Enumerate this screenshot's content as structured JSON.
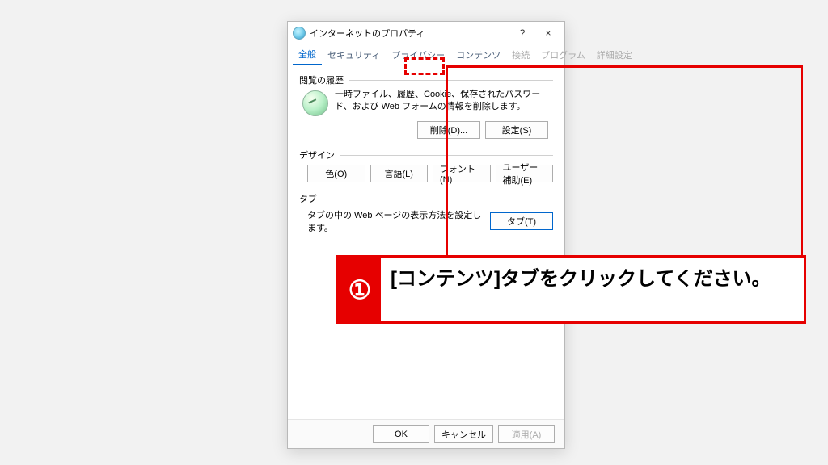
{
  "dialog": {
    "title": "インターネットのプロパティ",
    "help_label": "?",
    "close_label": "×"
  },
  "tabs": {
    "general": "全般",
    "security": "セキュリティ",
    "privacy": "プライバシー",
    "contents": "コンテンツ",
    "connections": "接続",
    "programs": "プログラム",
    "advanced": "詳細設定"
  },
  "history": {
    "group_title": "閲覧の履歴",
    "description": "一時ファイル、履歴、Cookie、保存されたパスワード、および Web フォームの情報を削除します。",
    "delete_btn": "削除(D)...",
    "settings_btn": "設定(S)"
  },
  "design": {
    "group_title": "デザイン",
    "colors_btn": "色(O)",
    "languages_btn": "言語(L)",
    "fonts_btn": "フォント(N)",
    "accessibility_btn": "ユーザー補助(E)"
  },
  "tab_section": {
    "group_title": "タブ",
    "description": "タブの中の Web ページの表示方法を設定します。",
    "tabs_btn": "タブ(T)"
  },
  "bottom": {
    "ok": "OK",
    "cancel": "キャンセル",
    "apply": "適用(A)"
  },
  "annotation": {
    "step_num": "①",
    "instruction": "[コンテンツ]タブをクリックしてください。"
  }
}
